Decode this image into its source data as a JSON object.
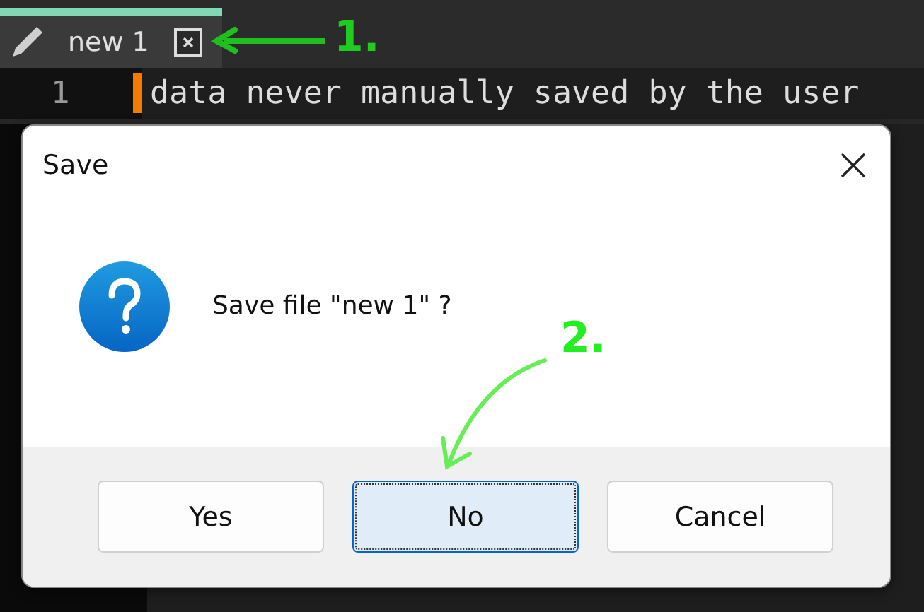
{
  "tabs": [
    {
      "label": "new 1",
      "selected": true
    }
  ],
  "editor": {
    "lines": [
      {
        "number": "1",
        "text": "data never manually saved by the user",
        "modified": true
      }
    ]
  },
  "dialog": {
    "title": "Save",
    "message": "Save file \"new 1\" ?",
    "buttons": [
      {
        "label": "Yes",
        "selected": false
      },
      {
        "label": "No",
        "selected": true
      },
      {
        "label": "Cancel",
        "selected": false
      }
    ]
  },
  "annotations": [
    {
      "label": "1."
    },
    {
      "label": "2."
    }
  ]
}
